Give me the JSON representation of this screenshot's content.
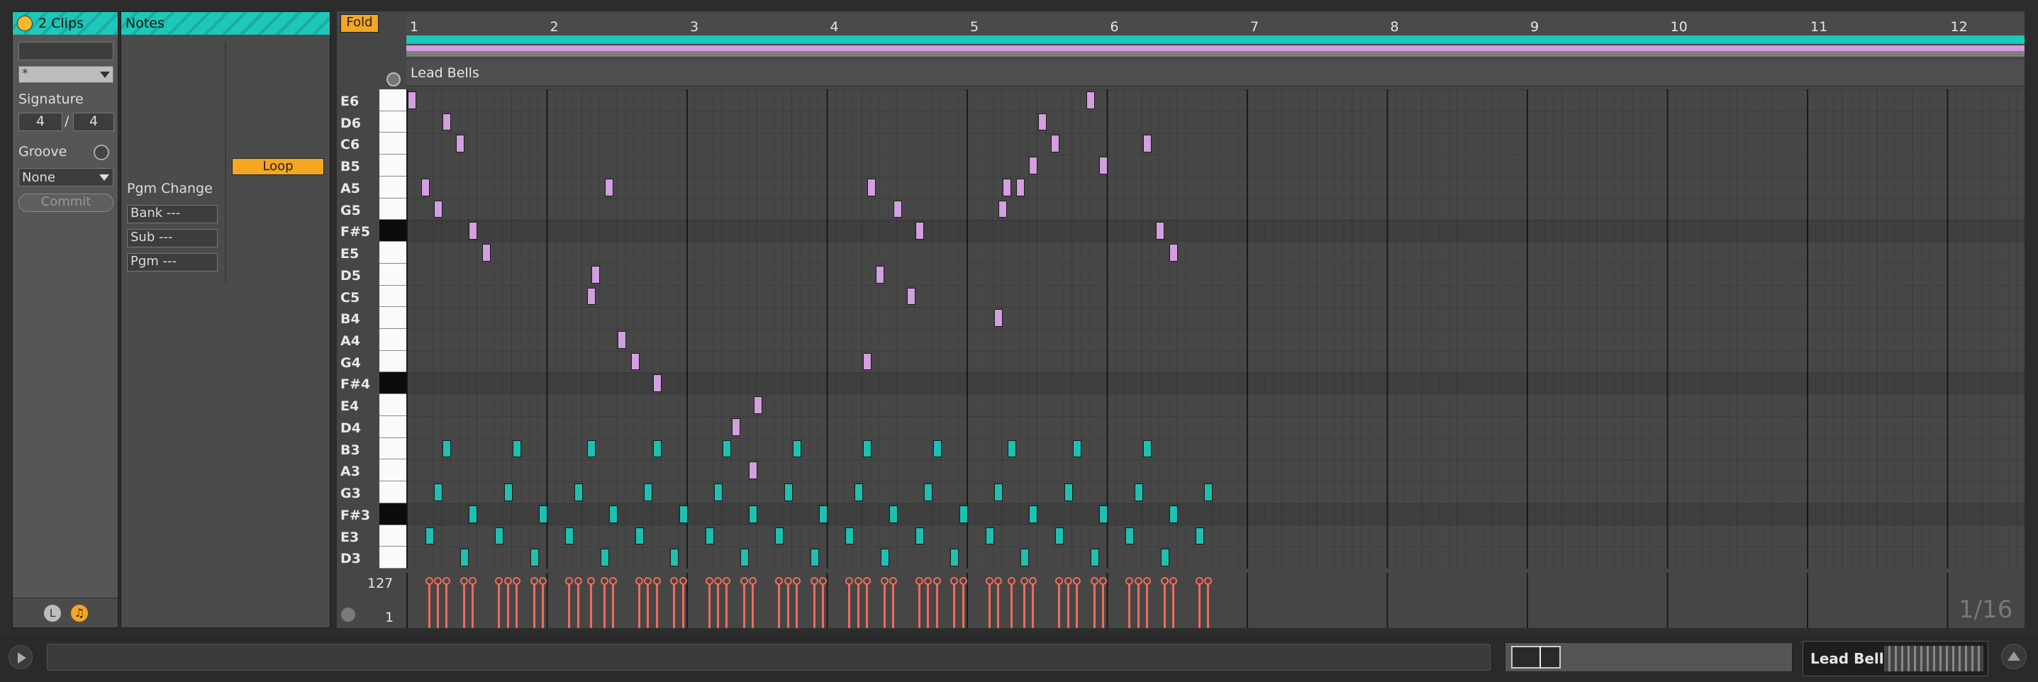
{
  "clip_panel": {
    "title": "2 Clips",
    "select_value": "*",
    "signature_label": "Signature",
    "sig_numerator": "4",
    "sig_slash": "/",
    "sig_denominator": "4",
    "groove_label": "Groove",
    "groove_value": "None",
    "commit_label": "Commit",
    "footer_l": "L"
  },
  "notes_panel": {
    "title": "Notes",
    "loop_label": "Loop",
    "pgm_change_label": "Pgm Change",
    "bank": "Bank ---",
    "sub": "Sub ---",
    "pgm": "Pgm ---"
  },
  "editor": {
    "fold_label": "Fold",
    "clip_name": "Lead Bells",
    "bars": [
      "1",
      "2",
      "3",
      "4",
      "5",
      "6",
      "7",
      "8",
      "9",
      "10",
      "11",
      "12"
    ],
    "pitch_labels": [
      "E6",
      "D6",
      "C6",
      "B5",
      "A5",
      "G5",
      "F#5",
      "E5",
      "D5",
      "C5",
      "B4",
      "A4",
      "G4",
      "F#4",
      "E4",
      "D4",
      "B3",
      "A3",
      "G3",
      "F#3",
      "E3",
      "D3"
    ],
    "black_rows": [
      6,
      13,
      19
    ],
    "velocity_max": "127",
    "velocity_min": "1",
    "grid_label": "1/16"
  },
  "notes": [
    {
      "pitch": "E6",
      "beat": 0.0,
      "clip": "pink"
    },
    {
      "pitch": "D6",
      "beat": 1.0,
      "clip": "pink"
    },
    {
      "pitch": "C6",
      "beat": 1.375,
      "clip": "pink"
    },
    {
      "pitch": "A5",
      "beat": 0.375,
      "clip": "pink"
    },
    {
      "pitch": "G5",
      "beat": 0.75,
      "clip": "pink"
    },
    {
      "pitch": "F#5",
      "beat": 1.75,
      "clip": "pink"
    },
    {
      "pitch": "E5",
      "beat": 2.125,
      "clip": "pink"
    },
    {
      "pitch": "D5",
      "beat": 5.25,
      "clip": "pink"
    },
    {
      "pitch": "C5",
      "beat": 5.125,
      "clip": "pink"
    },
    {
      "pitch": "A5",
      "beat": 5.625,
      "clip": "pink"
    },
    {
      "pitch": "A4",
      "beat": 6.0,
      "clip": "pink"
    },
    {
      "pitch": "G4",
      "beat": 6.375,
      "clip": "pink"
    },
    {
      "pitch": "F#4",
      "beat": 7.0,
      "clip": "pink"
    },
    {
      "pitch": "E4",
      "beat": 9.875,
      "clip": "pink"
    },
    {
      "pitch": "D4",
      "beat": 9.25,
      "clip": "pink"
    },
    {
      "pitch": "A3",
      "beat": 9.75,
      "clip": "pink"
    },
    {
      "pitch": "A5",
      "beat": 13.125,
      "clip": "pink"
    },
    {
      "pitch": "G4",
      "beat": 13.0,
      "clip": "pink"
    },
    {
      "pitch": "D5",
      "beat": 13.375,
      "clip": "pink"
    },
    {
      "pitch": "G5",
      "beat": 13.875,
      "clip": "pink"
    },
    {
      "pitch": "C5",
      "beat": 14.25,
      "clip": "pink"
    },
    {
      "pitch": "F#5",
      "beat": 14.5,
      "clip": "pink"
    },
    {
      "pitch": "B4",
      "beat": 16.75,
      "clip": "pink"
    },
    {
      "pitch": "G5",
      "beat": 16.875,
      "clip": "pink"
    },
    {
      "pitch": "A5",
      "beat": 17.0,
      "clip": "pink"
    },
    {
      "pitch": "A5",
      "beat": 17.375,
      "clip": "pink"
    },
    {
      "pitch": "B5",
      "beat": 17.75,
      "clip": "pink"
    },
    {
      "pitch": "D6",
      "beat": 18.0,
      "clip": "pink"
    },
    {
      "pitch": "C6",
      "beat": 18.375,
      "clip": "pink"
    },
    {
      "pitch": "E6",
      "beat": 19.375,
      "clip": "pink"
    },
    {
      "pitch": "B5",
      "beat": 19.75,
      "clip": "pink"
    },
    {
      "pitch": "C6",
      "beat": 21.0,
      "clip": "pink"
    },
    {
      "pitch": "F#5",
      "beat": 21.375,
      "clip": "pink"
    },
    {
      "pitch": "E5",
      "beat": 21.75,
      "clip": "pink"
    },
    {
      "pitch": "E3",
      "beat": 0.5,
      "clip": "teal"
    },
    {
      "pitch": "G3",
      "beat": 0.75,
      "clip": "teal"
    },
    {
      "pitch": "B3",
      "beat": 1.0,
      "clip": "teal"
    },
    {
      "pitch": "D3",
      "beat": 1.5,
      "clip": "teal"
    },
    {
      "pitch": "F#3",
      "beat": 1.75,
      "clip": "teal"
    },
    {
      "pitch": "E3",
      "beat": 2.5,
      "clip": "teal"
    },
    {
      "pitch": "G3",
      "beat": 2.75,
      "clip": "teal"
    },
    {
      "pitch": "B3",
      "beat": 3.0,
      "clip": "teal"
    },
    {
      "pitch": "D3",
      "beat": 3.5,
      "clip": "teal"
    },
    {
      "pitch": "F#3",
      "beat": 3.75,
      "clip": "teal"
    },
    {
      "pitch": "E3",
      "beat": 4.5,
      "clip": "teal"
    },
    {
      "pitch": "G3",
      "beat": 4.75,
      "clip": "teal"
    },
    {
      "pitch": "B3",
      "beat": 5.125,
      "clip": "teal"
    },
    {
      "pitch": "D3",
      "beat": 5.5,
      "clip": "teal"
    },
    {
      "pitch": "F#3",
      "beat": 5.75,
      "clip": "teal"
    },
    {
      "pitch": "E3",
      "beat": 6.5,
      "clip": "teal"
    },
    {
      "pitch": "G3",
      "beat": 6.75,
      "clip": "teal"
    },
    {
      "pitch": "B3",
      "beat": 7.0,
      "clip": "teal"
    },
    {
      "pitch": "D3",
      "beat": 7.5,
      "clip": "teal"
    },
    {
      "pitch": "F#3",
      "beat": 7.75,
      "clip": "teal"
    },
    {
      "pitch": "E3",
      "beat": 8.5,
      "clip": "teal"
    },
    {
      "pitch": "G3",
      "beat": 8.75,
      "clip": "teal"
    },
    {
      "pitch": "B3",
      "beat": 9.0,
      "clip": "teal"
    },
    {
      "pitch": "D3",
      "beat": 9.5,
      "clip": "teal"
    },
    {
      "pitch": "F#3",
      "beat": 9.75,
      "clip": "teal"
    },
    {
      "pitch": "E3",
      "beat": 10.5,
      "clip": "teal"
    },
    {
      "pitch": "G3",
      "beat": 10.75,
      "clip": "teal"
    },
    {
      "pitch": "B3",
      "beat": 11.0,
      "clip": "teal"
    },
    {
      "pitch": "D3",
      "beat": 11.5,
      "clip": "teal"
    },
    {
      "pitch": "F#3",
      "beat": 11.75,
      "clip": "teal"
    },
    {
      "pitch": "E3",
      "beat": 12.5,
      "clip": "teal"
    },
    {
      "pitch": "G3",
      "beat": 12.75,
      "clip": "teal"
    },
    {
      "pitch": "B3",
      "beat": 13.0,
      "clip": "teal"
    },
    {
      "pitch": "D3",
      "beat": 13.5,
      "clip": "teal"
    },
    {
      "pitch": "F#3",
      "beat": 13.75,
      "clip": "teal"
    },
    {
      "pitch": "E3",
      "beat": 14.5,
      "clip": "teal"
    },
    {
      "pitch": "G3",
      "beat": 14.75,
      "clip": "teal"
    },
    {
      "pitch": "B3",
      "beat": 15.0,
      "clip": "teal"
    },
    {
      "pitch": "D3",
      "beat": 15.5,
      "clip": "teal"
    },
    {
      "pitch": "F#3",
      "beat": 15.75,
      "clip": "teal"
    },
    {
      "pitch": "E3",
      "beat": 16.5,
      "clip": "teal"
    },
    {
      "pitch": "G3",
      "beat": 16.75,
      "clip": "teal"
    },
    {
      "pitch": "B3",
      "beat": 17.125,
      "clip": "teal"
    },
    {
      "pitch": "D3",
      "beat": 17.5,
      "clip": "teal"
    },
    {
      "pitch": "F#3",
      "beat": 17.75,
      "clip": "teal"
    },
    {
      "pitch": "E3",
      "beat": 18.5,
      "clip": "teal"
    },
    {
      "pitch": "G3",
      "beat": 18.75,
      "clip": "teal"
    },
    {
      "pitch": "B3",
      "beat": 19.0,
      "clip": "teal"
    },
    {
      "pitch": "D3",
      "beat": 19.5,
      "clip": "teal"
    },
    {
      "pitch": "F#3",
      "beat": 19.75,
      "clip": "teal"
    },
    {
      "pitch": "E3",
      "beat": 20.5,
      "clip": "teal"
    },
    {
      "pitch": "G3",
      "beat": 20.75,
      "clip": "teal"
    },
    {
      "pitch": "B3",
      "beat": 21.0,
      "clip": "teal"
    },
    {
      "pitch": "D3",
      "beat": 21.5,
      "clip": "teal"
    },
    {
      "pitch": "F#3",
      "beat": 21.75,
      "clip": "teal"
    },
    {
      "pitch": "E3",
      "beat": 22.5,
      "clip": "teal"
    },
    {
      "pitch": "G3",
      "beat": 22.75,
      "clip": "teal"
    }
  ],
  "bottom_bar": {
    "clip_name": "Lead Bells"
  },
  "colors": {
    "accent": "#1dc7b9",
    "loop_orange": "#f5a623",
    "note_pink": "#d49ee0",
    "note_teal": "#1fc0b2",
    "velocity": "#f26a5b"
  },
  "icons": [
    "play-icon",
    "cycle-icon",
    "groove-hot-swap-icon",
    "circle-clip-icon",
    "note-icon",
    "up-arrow-icon"
  ]
}
